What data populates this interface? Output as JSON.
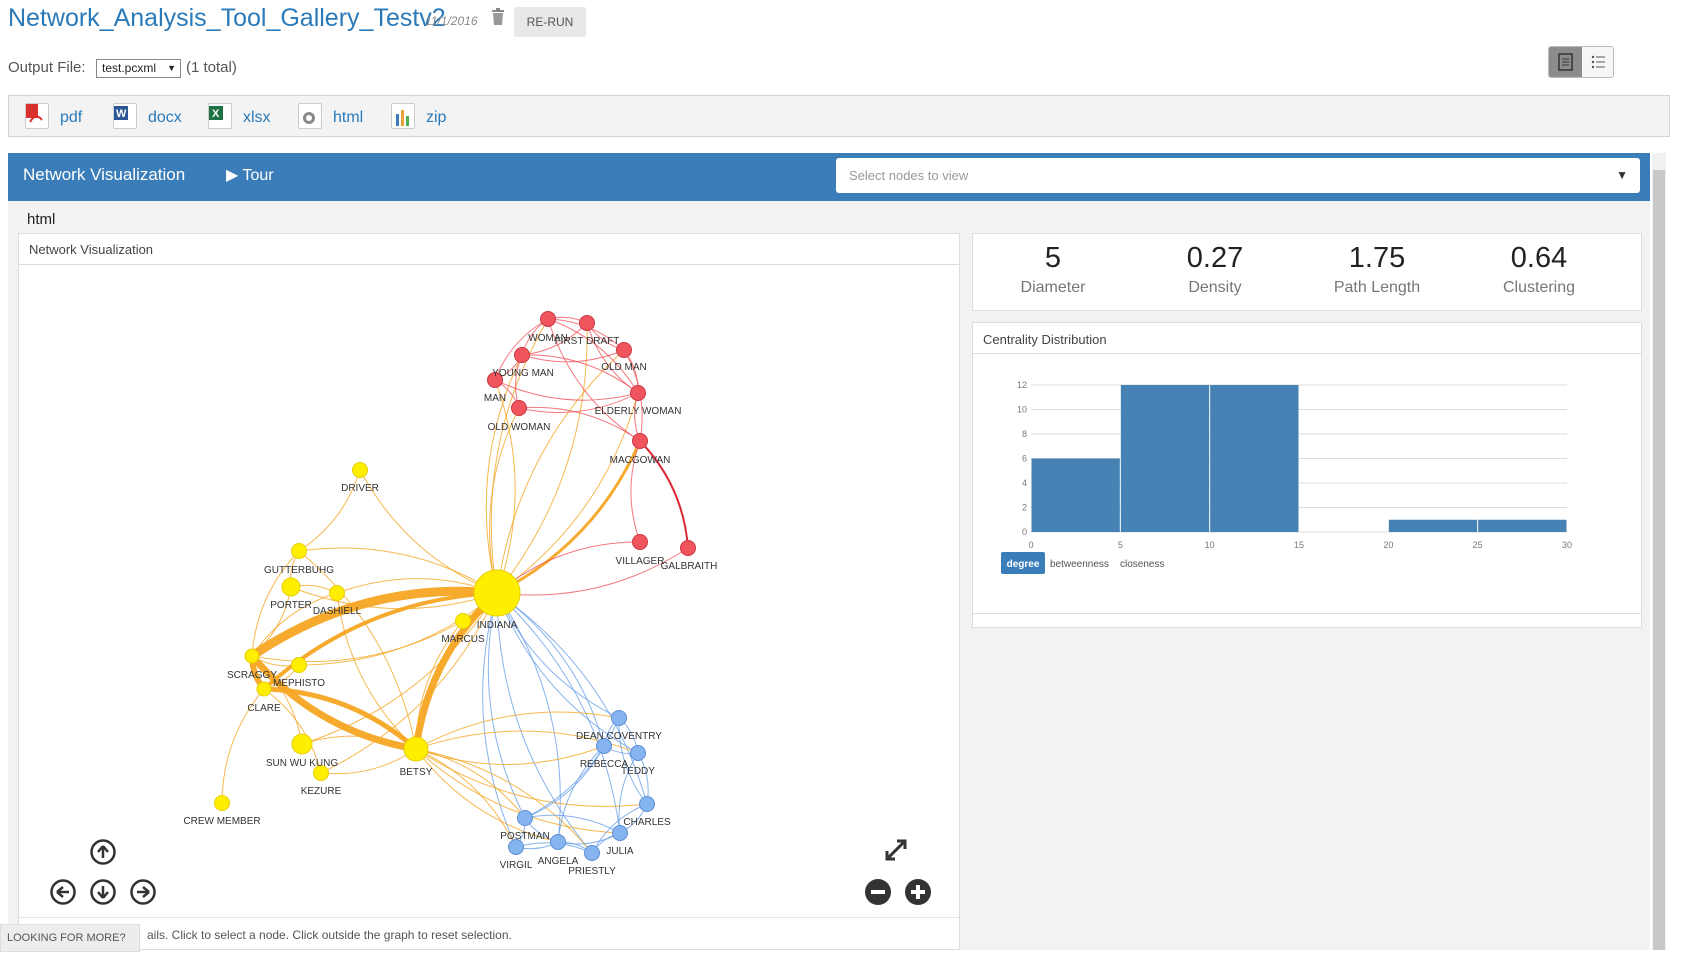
{
  "header": {
    "title": "Network_Analysis_Tool_Gallery_Testv2",
    "date": "11/1/2016",
    "rerun_label": "RE-RUN"
  },
  "output": {
    "label": "Output File:",
    "selected_file": "test.pcxml",
    "total": "(1 total)"
  },
  "downloads": [
    {
      "label": "pdf",
      "icon": "pdf-file-icon",
      "color": "#d9302c"
    },
    {
      "label": "docx",
      "icon": "word-file-icon",
      "color": "#2b5797"
    },
    {
      "label": "xlsx",
      "icon": "excel-file-icon",
      "color": "#1e7145"
    },
    {
      "label": "html",
      "icon": "html-file-icon",
      "color": "#555555"
    },
    {
      "label": "zip",
      "icon": "zip-file-icon",
      "color": "#3a7db9"
    }
  ],
  "panel": {
    "title": "Network Visualization",
    "tour_label": "Tour",
    "node_select_placeholder": "Select nodes to view",
    "section_label": "html",
    "graph_title": "Network Visualization",
    "footer_hint": "ails. Click to select a node. Click outside the graph to reset selection."
  },
  "metrics": [
    {
      "value": "5",
      "label": "Diameter"
    },
    {
      "value": "0.27",
      "label": "Density"
    },
    {
      "value": "1.75",
      "label": "Path Length"
    },
    {
      "value": "0.64",
      "label": "Clustering"
    }
  ],
  "centrality": {
    "title": "Centrality Distribution",
    "tabs": [
      "degree",
      "betweenness",
      "closeness"
    ],
    "active_tab": "degree"
  },
  "chart_data": {
    "type": "bar",
    "title": "Centrality Distribution",
    "bins": [
      [
        0,
        5
      ],
      [
        5,
        10
      ],
      [
        10,
        15
      ],
      [
        15,
        20
      ],
      [
        20,
        25
      ],
      [
        25,
        30
      ]
    ],
    "values": [
      6,
      12,
      12,
      0,
      1,
      1
    ],
    "xticks": [
      "0",
      "5",
      "10",
      "15",
      "20",
      "25",
      "30"
    ],
    "yticks": [
      "0",
      "2",
      "4",
      "6",
      "8",
      "10",
      "12"
    ],
    "xlim": [
      0,
      30
    ],
    "ylim": [
      0,
      12
    ],
    "grid": true,
    "color": "#4682b4"
  },
  "graph": {
    "groups": {
      "red": "#f0555e",
      "yellow": "#ffee00",
      "blue": "#86b4f0"
    },
    "nodes": [
      {
        "id": "WOMAN",
        "g": "red"
      },
      {
        "id": "FIRST DRAFT",
        "g": "red"
      },
      {
        "id": "YOUNG MAN",
        "g": "red"
      },
      {
        "id": "OLD MAN",
        "g": "red"
      },
      {
        "id": "MAN",
        "g": "red"
      },
      {
        "id": "ELDERLY WOMAN",
        "g": "red"
      },
      {
        "id": "OLD WOMAN",
        "g": "red"
      },
      {
        "id": "MACGOWAN",
        "g": "red"
      },
      {
        "id": "VILLAGER",
        "g": "red"
      },
      {
        "id": "GALBRAITH",
        "g": "red"
      },
      {
        "id": "DRIVER",
        "g": "yellow"
      },
      {
        "id": "GUTTERBUHG",
        "g": "yellow"
      },
      {
        "id": "PORTER",
        "g": "yellow"
      },
      {
        "id": "DASHIELL",
        "g": "yellow"
      },
      {
        "id": "INDIANA",
        "g": "yellow"
      },
      {
        "id": "MARCUS",
        "g": "yellow"
      },
      {
        "id": "SCRAGGY",
        "g": "yellow"
      },
      {
        "id": "MEPHISTO",
        "g": "yellow"
      },
      {
        "id": "CLARE",
        "g": "yellow"
      },
      {
        "id": "SUN WU KUNG",
        "g": "yellow"
      },
      {
        "id": "BETSY",
        "g": "yellow"
      },
      {
        "id": "KEZURE",
        "g": "yellow"
      },
      {
        "id": "CREW MEMBER",
        "g": "yellow"
      },
      {
        "id": "DEAN COVENTRY",
        "g": "blue"
      },
      {
        "id": "REBECCA",
        "g": "blue"
      },
      {
        "id": "TEDDY",
        "g": "blue"
      },
      {
        "id": "CHARLES",
        "g": "blue"
      },
      {
        "id": "POSTMAN",
        "g": "blue"
      },
      {
        "id": "JULIA",
        "g": "blue"
      },
      {
        "id": "VIRGIL",
        "g": "blue"
      },
      {
        "id": "ANGELA",
        "g": "blue"
      },
      {
        "id": "PRIESTLY",
        "g": "blue"
      }
    ],
    "edges": [
      [
        "INDIANA",
        "WOMAN"
      ],
      [
        "INDIANA",
        "FIRST DRAFT"
      ],
      [
        "INDIANA",
        "YOUNG MAN"
      ],
      [
        "INDIANA",
        "MAN"
      ],
      [
        "INDIANA",
        "OLD MAN"
      ],
      [
        "INDIANA",
        "ELDERLY WOMAN"
      ],
      [
        "INDIANA",
        "OLD WOMAN"
      ],
      [
        "INDIANA",
        "MACGOWAN"
      ],
      [
        "INDIANA",
        "VILLAGER"
      ],
      [
        "INDIANA",
        "GALBRAITH"
      ],
      [
        "MACGOWAN",
        "GALBRAITH"
      ],
      [
        "MACGOWAN",
        "VILLAGER"
      ],
      [
        "MACGOWAN",
        "ELDERLY WOMAN"
      ],
      [
        "MACGOWAN",
        "OLD MAN"
      ],
      [
        "MACGOWAN",
        "WOMAN"
      ],
      [
        "MACGOWAN",
        "OLD WOMAN"
      ],
      [
        "WOMAN",
        "FIRST DRAFT"
      ],
      [
        "WOMAN",
        "YOUNG MAN"
      ],
      [
        "WOMAN",
        "OLD MAN"
      ],
      [
        "WOMAN",
        "MAN"
      ],
      [
        "WOMAN",
        "ELDERLY WOMAN"
      ],
      [
        "FIRST DRAFT",
        "OLD MAN"
      ],
      [
        "FIRST DRAFT",
        "YOUNG MAN"
      ],
      [
        "FIRST DRAFT",
        "ELDERLY WOMAN"
      ],
      [
        "YOUNG MAN",
        "MAN"
      ],
      [
        "YOUNG MAN",
        "OLD WOMAN"
      ],
      [
        "YOUNG MAN",
        "ELDERLY WOMAN"
      ],
      [
        "YOUNG MAN",
        "OLD MAN"
      ],
      [
        "MAN",
        "OLD WOMAN"
      ],
      [
        "OLD WOMAN",
        "ELDERLY WOMAN"
      ],
      [
        "OLD MAN",
        "ELDERLY WOMAN"
      ],
      [
        "MAN",
        "ELDERLY WOMAN"
      ],
      [
        "INDIANA",
        "DRIVER"
      ],
      [
        "INDIANA",
        "GUTTERBUHG"
      ],
      [
        "INDIANA",
        "PORTER"
      ],
      [
        "INDIANA",
        "DASHIELL"
      ],
      [
        "INDIANA",
        "MARCUS"
      ],
      [
        "INDIANA",
        "SCRAGGY"
      ],
      [
        "INDIANA",
        "MEPHISTO"
      ],
      [
        "INDIANA",
        "CLARE"
      ],
      [
        "INDIANA",
        "SUN WU KUNG"
      ],
      [
        "INDIANA",
        "BETSY"
      ],
      [
        "INDIANA",
        "KEZURE"
      ],
      [
        "SCRAGGY",
        "BETSY"
      ],
      [
        "CLARE",
        "BETSY"
      ],
      [
        "SCRAGGY",
        "CLARE"
      ],
      [
        "SCRAGGY",
        "GUTTERBUHG"
      ],
      [
        "SCRAGGY",
        "PORTER"
      ],
      [
        "SCRAGGY",
        "DASHIELL"
      ],
      [
        "SCRAGGY",
        "MEPHISTO"
      ],
      [
        "SCRAGGY",
        "SUN WU KUNG"
      ],
      [
        "CLARE",
        "MEPHISTO"
      ],
      [
        "CLARE",
        "KEZURE"
      ],
      [
        "CLARE",
        "CREW MEMBER"
      ],
      [
        "BETSY",
        "MARCUS"
      ],
      [
        "BETSY",
        "SUN WU KUNG"
      ],
      [
        "BETSY",
        "KEZURE"
      ],
      [
        "BETSY",
        "GUTTERBUHG"
      ],
      [
        "DRIVER",
        "GUTTERBUHG"
      ],
      [
        "GUTTERBUHG",
        "PORTER"
      ],
      [
        "PORTER",
        "DASHIELL"
      ],
      [
        "DASHIELL",
        "BETSY"
      ],
      [
        "MARCUS",
        "SCRAGGY"
      ],
      [
        "INDIANA",
        "DEAN COVENTRY"
      ],
      [
        "INDIANA",
        "REBECCA"
      ],
      [
        "INDIANA",
        "TEDDY"
      ],
      [
        "INDIANA",
        "CHARLES"
      ],
      [
        "INDIANA",
        "POSTMAN"
      ],
      [
        "INDIANA",
        "JULIA"
      ],
      [
        "INDIANA",
        "VIRGIL"
      ],
      [
        "INDIANA",
        "ANGELA"
      ],
      [
        "INDIANA",
        "PRIESTLY"
      ],
      [
        "BETSY",
        "DEAN COVENTRY"
      ],
      [
        "BETSY",
        "REBECCA"
      ],
      [
        "BETSY",
        "TEDDY"
      ],
      [
        "BETSY",
        "CHARLES"
      ],
      [
        "BETSY",
        "POSTMAN"
      ],
      [
        "BETSY",
        "JULIA"
      ],
      [
        "BETSY",
        "VIRGIL"
      ],
      [
        "BETSY",
        "ANGELA"
      ],
      [
        "BETSY",
        "PRIESTLY"
      ],
      [
        "DEAN COVENTRY",
        "REBECCA"
      ],
      [
        "DEAN COVENTRY",
        "TEDDY"
      ],
      [
        "DEAN COVENTRY",
        "CHARLES"
      ],
      [
        "DEAN COVENTRY",
        "POSTMAN"
      ],
      [
        "REBECCA",
        "TEDDY"
      ],
      [
        "REBECCA",
        "POSTMAN"
      ],
      [
        "REBECCA",
        "ANGELA"
      ],
      [
        "TEDDY",
        "CHARLES"
      ],
      [
        "TEDDY",
        "JULIA"
      ],
      [
        "CHARLES",
        "JULIA"
      ],
      [
        "CHARLES",
        "PRIESTLY"
      ],
      [
        "POSTMAN",
        "VIRGIL"
      ],
      [
        "POSTMAN",
        "ANGELA"
      ],
      [
        "POSTMAN",
        "JULIA"
      ],
      [
        "VIRGIL",
        "ANGELA"
      ],
      [
        "ANGELA",
        "PRIESTLY"
      ],
      [
        "JULIA",
        "PRIESTLY"
      ],
      [
        "VIRGIL",
        "PRIESTLY"
      ],
      [
        "ANGELA",
        "JULIA"
      ]
    ]
  },
  "controls": {
    "pan_up": "arrow-up-icon",
    "pan_left": "arrow-left-icon",
    "pan_down": "arrow-down-icon",
    "pan_right": "arrow-right-icon",
    "zoom_out": "zoom-out-icon",
    "zoom_in": "zoom-in-icon",
    "fullscreen": "fullscreen-icon"
  },
  "looking_more": "LOOKING FOR MORE?"
}
